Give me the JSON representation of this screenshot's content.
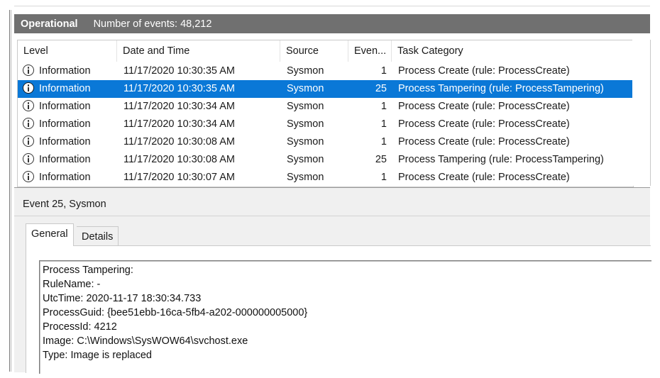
{
  "header": {
    "title": "Operational",
    "count_label": "Number of events: 48,212"
  },
  "columns": [
    "Level",
    "Date and Time",
    "Source",
    "Even...",
    "Task Category"
  ],
  "rows": [
    {
      "level": "Information",
      "datetime": "11/17/2020 10:30:35 AM",
      "source": "Sysmon",
      "event_id": "1",
      "task": "Process Create (rule: ProcessCreate)",
      "selected": false
    },
    {
      "level": "Information",
      "datetime": "11/17/2020 10:30:35 AM",
      "source": "Sysmon",
      "event_id": "25",
      "task": "Process Tampering (rule: ProcessTampering)",
      "selected": true
    },
    {
      "level": "Information",
      "datetime": "11/17/2020 10:30:34 AM",
      "source": "Sysmon",
      "event_id": "1",
      "task": "Process Create (rule: ProcessCreate)",
      "selected": false
    },
    {
      "level": "Information",
      "datetime": "11/17/2020 10:30:34 AM",
      "source": "Sysmon",
      "event_id": "1",
      "task": "Process Create (rule: ProcessCreate)",
      "selected": false
    },
    {
      "level": "Information",
      "datetime": "11/17/2020 10:30:08 AM",
      "source": "Sysmon",
      "event_id": "1",
      "task": "Process Create (rule: ProcessCreate)",
      "selected": false
    },
    {
      "level": "Information",
      "datetime": "11/17/2020 10:30:08 AM",
      "source": "Sysmon",
      "event_id": "25",
      "task": "Process Tampering (rule: ProcessTampering)",
      "selected": false
    },
    {
      "level": "Information",
      "datetime": "11/17/2020 10:30:07 AM",
      "source": "Sysmon",
      "event_id": "1",
      "task": "Process Create (rule: ProcessCreate)",
      "selected": false
    }
  ],
  "detail": {
    "title": "Event 25, Sysmon",
    "tabs": {
      "general": "General",
      "details": "Details"
    },
    "lines": [
      "Process Tampering:",
      "RuleName: -",
      "UtcTime: 2020-11-17 18:30:34.733",
      "ProcessGuid: {bee51ebb-16ca-5fb4-a202-000000005000}",
      "ProcessId: 4212",
      "Image: C:\\Windows\\SysWOW64\\svchost.exe",
      "Type: Image is replaced"
    ]
  },
  "icons": {
    "level_icon": "info-icon"
  },
  "colors": {
    "selection": "#0a78d7",
    "header_bar": "#707070"
  }
}
